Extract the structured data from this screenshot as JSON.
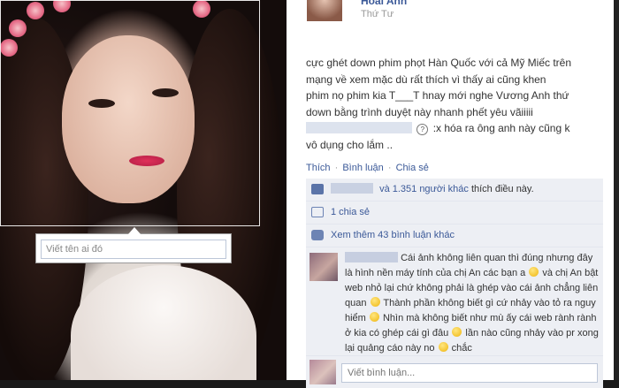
{
  "photo": {
    "tag_placeholder": "Viết tên ai đó"
  },
  "post": {
    "author": "Hoài Anh",
    "date": "Thứ Tư",
    "lines": [
      "cực ghét down phim phọt Hàn Quốc với cả Mỹ Miếc trên",
      "mạng về xem mặc dù rất thích vì thấy ai cũng khen",
      "phim nọ phim kia T___T hnay mới nghe Vương Anh thứ",
      "down bằng trình duyệt này nhanh phết yêu vãiiiii"
    ],
    "line5_suffix": ":x hóa ra ông anh này cũng k",
    "line6": "vô dụng cho lắm .."
  },
  "actions": {
    "like": "Thích",
    "comment": "Bình luận",
    "share": "Chia sẻ",
    "separator": "·"
  },
  "ufi": {
    "likes_text": "và 1.351 người khác",
    "likes_suffix": "thích điều này.",
    "shares": "1 chia sẻ",
    "view_more": "Xem thêm 43 bình luận khác"
  },
  "comment": {
    "segments": [
      "Cái ảnh không liên quan thì đúng nhưng đây là hình nền máy tính của chị An các bạn a",
      "và chị An bật web nhỏ lại chứ không phải là ghép vào cái ảnh chẳng liên quan",
      "Thành phần không biết gì cứ nhảy vào tỏ ra nguy hiểm",
      "Nhìn mà không biết như mù ấy cái web rành rành ở kia có ghép cái gì đâu",
      "lần nào cũng nhảy vào pr xong lại quảng cáo này no",
      "chắc"
    ]
  },
  "write_comment": {
    "placeholder": "Viết bình luận..."
  },
  "colors": {
    "link": "#3b5998",
    "ufi_bg": "#edeff4"
  }
}
